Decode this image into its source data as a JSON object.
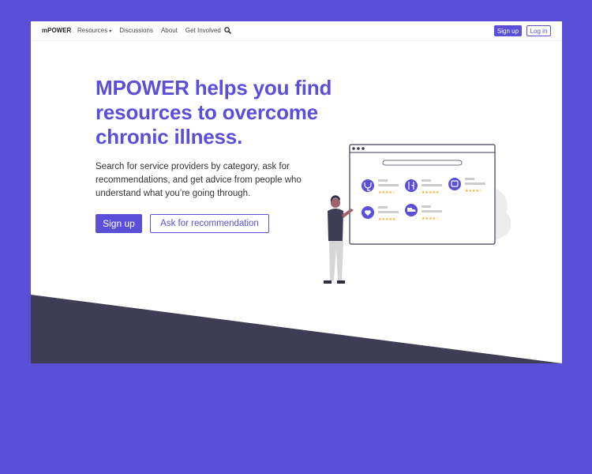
{
  "nav": {
    "brand": "mPOWER",
    "links": [
      {
        "label": "Resources",
        "has_caret": true
      },
      {
        "label": "Discussions"
      },
      {
        "label": "About"
      },
      {
        "label": "Get Involved"
      }
    ],
    "caret": "▾",
    "search_icon": "search-icon",
    "signup_label": "Sign up",
    "login_label": "Log in"
  },
  "hero": {
    "headline": "MPOWER helps you find resources to overcome chronic illness.",
    "subtext": "Search for service providers by category, ask for recommendations, and get advice from people who understand what you’re going through.",
    "signup_label": "Sign up",
    "recommend_label": "Ask for recommendation"
  },
  "illustration": {
    "icons": [
      "stethoscope-icon",
      "utensils-icon",
      "bus-icon",
      "heart-hand-icon",
      "truck-icon"
    ],
    "ratings": [
      "★★★★☆",
      "★★★★★",
      "★★★★☆",
      "★★★★★",
      "★★★★☆"
    ]
  },
  "colors": {
    "brand": "#5b4fd8",
    "dark_band": "#3f3d56",
    "star": "#f5a623",
    "page_bg": "#ffffff"
  }
}
